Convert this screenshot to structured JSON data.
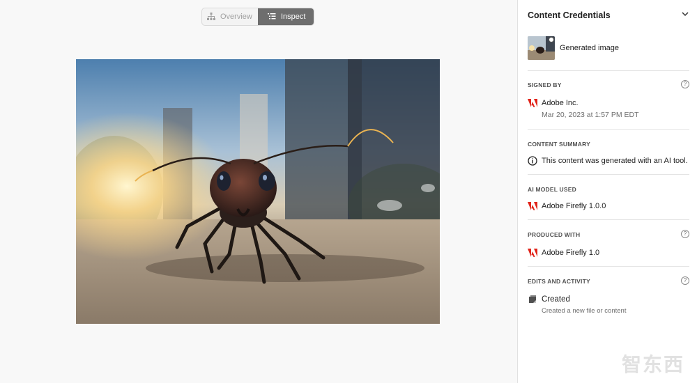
{
  "toolbar": {
    "overview_label": "Overview",
    "inspect_label": "Inspect",
    "active_tab": "Inspect",
    "accent_active": "#6e6e6e"
  },
  "canvas": {
    "subject": "ant-photo"
  },
  "panel": {
    "title": "Content Credentials",
    "asset_title": "Generated image",
    "signed_by": {
      "label": "SIGNED BY",
      "issuer": "Adobe Inc.",
      "date": "Mar 20, 2023 at 1:57 PM EDT",
      "icon": "adobe-icon"
    },
    "content_summary": {
      "label": "CONTENT SUMMARY",
      "text": "This content was generated with an AI tool.",
      "icon": "info-icon"
    },
    "ai_model": {
      "label": "AI MODEL USED",
      "value": "Adobe Firefly 1.0.0",
      "icon": "adobe-icon"
    },
    "produced_with": {
      "label": "PRODUCED WITH",
      "value": "Adobe Firefly 1.0",
      "icon": "adobe-icon"
    },
    "edits": {
      "label": "EDITS AND ACTIVITY",
      "action": "Created",
      "description": "Created a new file or content",
      "icon": "created-icon"
    },
    "brand_color": "#e1251b"
  },
  "watermark": {
    "text": "智东西"
  }
}
